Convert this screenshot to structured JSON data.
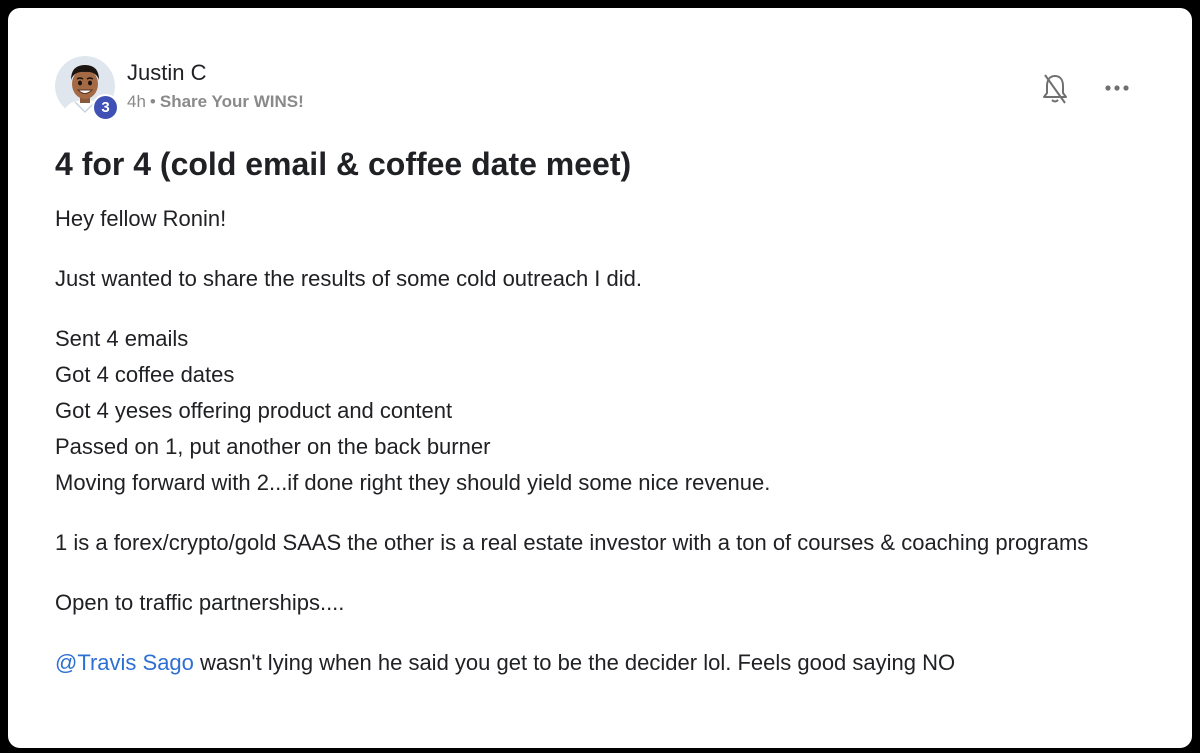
{
  "post": {
    "author": {
      "name": "Justin C",
      "level": "3",
      "avatar_icon": "avatar-cartoon-man-icon"
    },
    "meta": {
      "time": "4h",
      "separator": "•",
      "category": "Share Your WINS!"
    },
    "actions": {
      "bell_icon": "bell-off-icon",
      "more_icon": "more-horizontal-icon"
    },
    "title": "4 for 4 (cold email & coffee date meet)",
    "body": {
      "greeting": "Hey fellow Ronin!",
      "intro": "Just wanted to share the results of some cold outreach I did.",
      "results": [
        "Sent 4 emails",
        "Got 4 coffee dates",
        "Got 4 yeses offering product and content",
        "Passed on 1, put another on the back burner",
        "Moving forward with 2...if done right they should yield some nice revenue."
      ],
      "details": "1 is a forex/crypto/gold SAAS the other is a real estate investor with a ton of courses & coaching programs",
      "partnerships": "Open to traffic partnerships....",
      "mention": "@Travis Sago",
      "closing": " wasn't lying when he said you get to be the decider lol. Feels good saying NO"
    }
  },
  "colors": {
    "frame": "#000000",
    "card": "#ffffff",
    "text": "#202124",
    "meta": "#8a8a8a",
    "badge": "#3f51b5",
    "mention": "#2e6fd4"
  }
}
